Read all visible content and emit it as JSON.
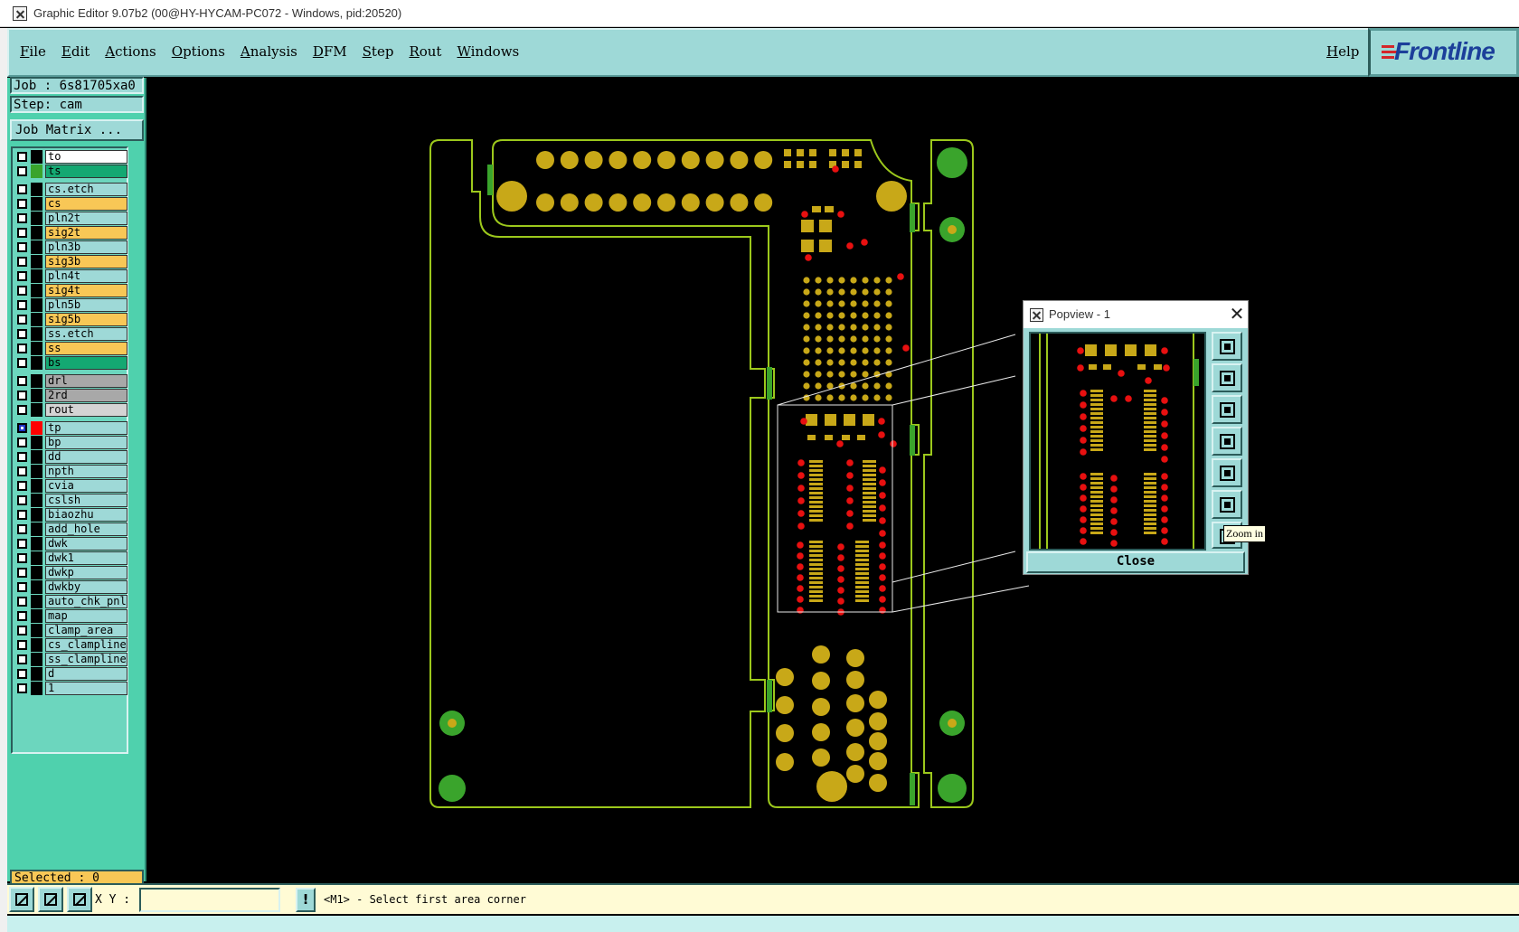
{
  "window": {
    "title": "Graphic Editor 9.07b2 (00@HY-HYCAM-PC072 - Windows, pid:20520)"
  },
  "menu": {
    "items": [
      "File",
      "Edit",
      "Actions",
      "Options",
      "Analysis",
      "DFM",
      "Step",
      "Rout",
      "Windows"
    ],
    "help": "Help"
  },
  "brand": {
    "logo_text": "Frontline",
    "color": "#1c3f9a",
    "accent": "#d4262a"
  },
  "job": {
    "job_label": "Job : 6s81705xa0",
    "step_label": "Step: cam",
    "matrix_button": "Job Matrix ..."
  },
  "layers": [
    {
      "name": "to",
      "style": "white",
      "swatch": "#000000"
    },
    {
      "name": "ts",
      "style": "green",
      "swatch": "#3aa42c"
    },
    {
      "name": "cs.etch",
      "style": "",
      "swatch": "#000000"
    },
    {
      "name": "cs",
      "style": "orange",
      "swatch": "#000000"
    },
    {
      "name": "pln2t",
      "style": "",
      "swatch": "#000000"
    },
    {
      "name": "sig2t",
      "style": "orange",
      "swatch": "#000000"
    },
    {
      "name": "pln3b",
      "style": "",
      "swatch": "#000000"
    },
    {
      "name": "sig3b",
      "style": "orange",
      "swatch": "#000000"
    },
    {
      "name": "pln4t",
      "style": "",
      "swatch": "#000000"
    },
    {
      "name": "sig4t",
      "style": "orange",
      "swatch": "#000000"
    },
    {
      "name": "pln5b",
      "style": "",
      "swatch": "#000000"
    },
    {
      "name": "sig5b",
      "style": "orange",
      "swatch": "#000000"
    },
    {
      "name": "ss.etch",
      "style": "",
      "swatch": "#000000"
    },
    {
      "name": "ss",
      "style": "orange",
      "swatch": "#000000"
    },
    {
      "name": "bs",
      "style": "green",
      "swatch": "#000000"
    },
    {
      "name": "drl",
      "style": "gray",
      "swatch": "#000000"
    },
    {
      "name": "2rd",
      "style": "gray",
      "swatch": "#000000"
    },
    {
      "name": "rout",
      "style": "lightgray",
      "swatch": "#000000"
    },
    {
      "name": "tp",
      "style": "",
      "swatch": "#ff0000",
      "active": true
    },
    {
      "name": "bp",
      "style": "",
      "swatch": "#000000"
    },
    {
      "name": "dd",
      "style": "",
      "swatch": "#000000"
    },
    {
      "name": "npth",
      "style": "",
      "swatch": "#000000"
    },
    {
      "name": "cvia",
      "style": "",
      "swatch": "#000000"
    },
    {
      "name": "cslsh",
      "style": "",
      "swatch": "#000000"
    },
    {
      "name": "biaozhu",
      "style": "",
      "swatch": "#000000"
    },
    {
      "name": "add_hole",
      "style": "",
      "swatch": "#000000"
    },
    {
      "name": "dwk",
      "style": "",
      "swatch": "#000000"
    },
    {
      "name": "dwk1",
      "style": "",
      "swatch": "#000000"
    },
    {
      "name": "dwkp",
      "style": "",
      "swatch": "#000000"
    },
    {
      "name": "dwkby",
      "style": "",
      "swatch": "#000000"
    },
    {
      "name": "auto_chk_pnl",
      "style": "",
      "swatch": "#000000"
    },
    {
      "name": "map",
      "style": "",
      "swatch": "#000000"
    },
    {
      "name": "clamp_area",
      "style": "",
      "swatch": "#000000"
    },
    {
      "name": "cs_clampline",
      "style": "",
      "swatch": "#000000"
    },
    {
      "name": "ss_clampline",
      "style": "",
      "swatch": "#000000"
    },
    {
      "name": "d",
      "style": "",
      "swatch": "#000000"
    },
    {
      "name": "1",
      "style": "",
      "swatch": "#000000"
    }
  ],
  "selection": {
    "label": "Selected : 0"
  },
  "popview": {
    "title": "Popview - 1",
    "close_label": "Close",
    "tooltip": "Zoom in"
  },
  "statusbar": {
    "xy_label": "X Y :",
    "xy_value": "",
    "alert_glyph": "!",
    "message": "<M1> - Select first area corner"
  },
  "colors": {
    "outline": "#9cc81c",
    "pad": "#c8a818",
    "red_pad": "#e81010",
    "green_pad": "#3aa42c",
    "panel": "#9ed9d7",
    "panel_dark": "#4fd1ad"
  }
}
